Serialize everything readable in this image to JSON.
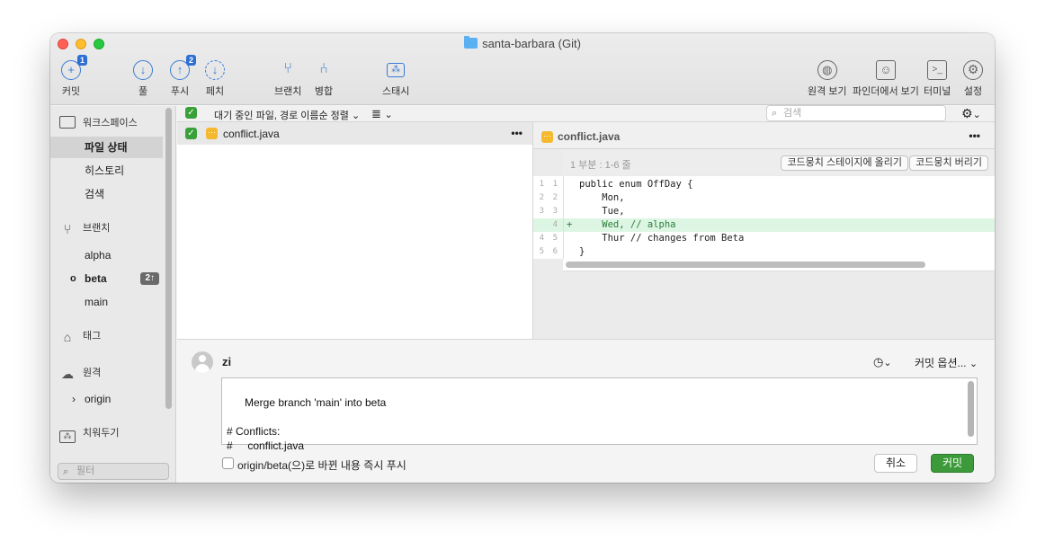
{
  "window": {
    "title": "santa-barbara (Git)"
  },
  "toolbar": {
    "commit": {
      "label": "커밋",
      "badge": "1"
    },
    "pull": {
      "label": "풀"
    },
    "push": {
      "label": "푸시",
      "badge": "2"
    },
    "fetch": {
      "label": "페치"
    },
    "branch": {
      "label": "브랜치"
    },
    "merge": {
      "label": "병합"
    },
    "stash": {
      "label": "스태시"
    },
    "remote_view": {
      "label": "원격 보기"
    },
    "finder_view": {
      "label": "파인더에서 보기"
    },
    "terminal": {
      "label": "터미널"
    },
    "settings": {
      "label": "설정"
    }
  },
  "sidebar": {
    "workspace": {
      "label": "워크스페이스"
    },
    "workspace_items": [
      {
        "label": "파일 상태",
        "selected": true
      },
      {
        "label": "히스토리"
      },
      {
        "label": "검색"
      }
    ],
    "branches": {
      "label": "브랜치"
    },
    "branch_items": [
      {
        "label": "alpha"
      },
      {
        "label": "beta",
        "current": true,
        "count": "2↑"
      },
      {
        "label": "main"
      }
    ],
    "tags": {
      "label": "태그"
    },
    "remotes": {
      "label": "원격"
    },
    "remote_items": [
      {
        "label": "origin"
      }
    ],
    "stashes": {
      "label": "치워두기"
    },
    "filter": {
      "placeholder": "필터"
    }
  },
  "filterbar": {
    "sort_label": "대기 중인 파일, 경로 이름순 정렬",
    "search_placeholder": "검색"
  },
  "files": [
    {
      "name": "conflict.java",
      "staged": true,
      "status": "conflict",
      "menu": "•••"
    }
  ],
  "diff": {
    "file_name": "conflict.java",
    "menu": "•••",
    "hunk_label": "1 부분 : 1-6 줄",
    "stage_hunk_label": "코드뭉치 스테이지에 올리기",
    "discard_hunk_label": "코드뭉치 버리기",
    "lines": [
      {
        "old": "1",
        "new": "1",
        "marker": "",
        "text": "public enum OffDay {",
        "type": "context"
      },
      {
        "old": "2",
        "new": "2",
        "marker": "",
        "text": "    Mon,",
        "type": "context"
      },
      {
        "old": "3",
        "new": "3",
        "marker": "",
        "text": "    Tue,",
        "type": "context"
      },
      {
        "old": "",
        "new": "4",
        "marker": "+",
        "text": "    Wed, // alpha",
        "type": "add"
      },
      {
        "old": "4",
        "new": "5",
        "marker": "",
        "text": "    Thur // changes from Beta",
        "type": "context"
      },
      {
        "old": "5",
        "new": "6",
        "marker": "",
        "text": "}",
        "type": "context"
      }
    ]
  },
  "commit": {
    "author": "zi",
    "options_label": "커밋 옵션...",
    "message": "Merge branch 'main' into beta\n\n# Conflicts:\n#     conflict.java",
    "push_checkbox_label": "origin/beta(으)로 바뀐 내용 즉시 푸시",
    "cancel_label": "취소",
    "commit_label": "커밋"
  },
  "colors": {
    "accent": "#3a7bd5",
    "commit_button": "#3c9a3a",
    "added_line_bg": "#ddf5e3",
    "conflict_icon": "#f4b92f"
  }
}
